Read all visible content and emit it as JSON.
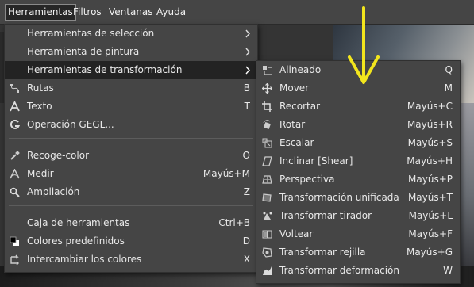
{
  "menubar": {
    "items": [
      {
        "label": "Herramientas",
        "active": true
      },
      {
        "label": "Filtros"
      },
      {
        "label": "Ventanas"
      },
      {
        "label": "Ayuda"
      }
    ]
  },
  "main_menu": {
    "items": [
      {
        "label": "Herramientas de selección",
        "accel": "",
        "submenu": true,
        "icon": ""
      },
      {
        "label": "Herramienta de pintura",
        "accel": "",
        "submenu": true,
        "icon": ""
      },
      {
        "label": "Herramientas de transformación",
        "accel": "",
        "submenu": true,
        "icon": "",
        "highlighted": true
      },
      {
        "label": "Rutas",
        "accel": "B",
        "icon": "paths-icon"
      },
      {
        "label": "Texto",
        "accel": "T",
        "icon": "text-icon"
      },
      {
        "label": "Operación GEGL...",
        "accel": "",
        "icon": "gegl-icon"
      },
      {
        "label": "Recoge-color",
        "accel": "O",
        "icon": "color-picker-icon"
      },
      {
        "label": "Medir",
        "accel": "Mayús+M",
        "icon": "measure-icon"
      },
      {
        "label": "Ampliación",
        "accel": "Z",
        "icon": "zoom-icon"
      },
      {
        "label": "Caja de herramientas",
        "accel": "Ctrl+B",
        "icon": ""
      },
      {
        "label": "Colores predefinidos",
        "accel": "D",
        "icon": "default-colors-icon"
      },
      {
        "label": "Intercambiar los colores",
        "accel": "X",
        "icon": "swap-colors-icon"
      }
    ]
  },
  "transform_menu": {
    "items": [
      {
        "label": "Alineado",
        "accel": "Q",
        "icon": "align-icon"
      },
      {
        "label": "Mover",
        "accel": "M",
        "icon": "move-icon"
      },
      {
        "label": "Recortar",
        "accel": "Mayús+C",
        "icon": "crop-icon"
      },
      {
        "label": "Rotar",
        "accel": "Mayús+R",
        "icon": "rotate-icon"
      },
      {
        "label": "Escalar",
        "accel": "Mayús+S",
        "icon": "scale-icon"
      },
      {
        "label": "Inclinar [Shear]",
        "accel": "Mayús+H",
        "icon": "shear-icon"
      },
      {
        "label": "Perspectiva",
        "accel": "Mayús+P",
        "icon": "perspective-icon"
      },
      {
        "label": "Transformación unificada",
        "accel": "Mayús+T",
        "icon": "unified-transform-icon"
      },
      {
        "label": "Transformar tirador",
        "accel": "Mayús+L",
        "icon": "handle-transform-icon"
      },
      {
        "label": "Voltear",
        "accel": "Mayús+F",
        "icon": "flip-icon"
      },
      {
        "label": "Transformar rejilla",
        "accel": "Mayús+G",
        "icon": "cage-transform-icon"
      },
      {
        "label": "Transformar deformación",
        "accel": "W",
        "icon": "warp-transform-icon"
      }
    ]
  },
  "colors": {
    "menu_bg": "#454545",
    "highlight_bg": "#232323",
    "annotation_arrow": "#f2e51d"
  }
}
